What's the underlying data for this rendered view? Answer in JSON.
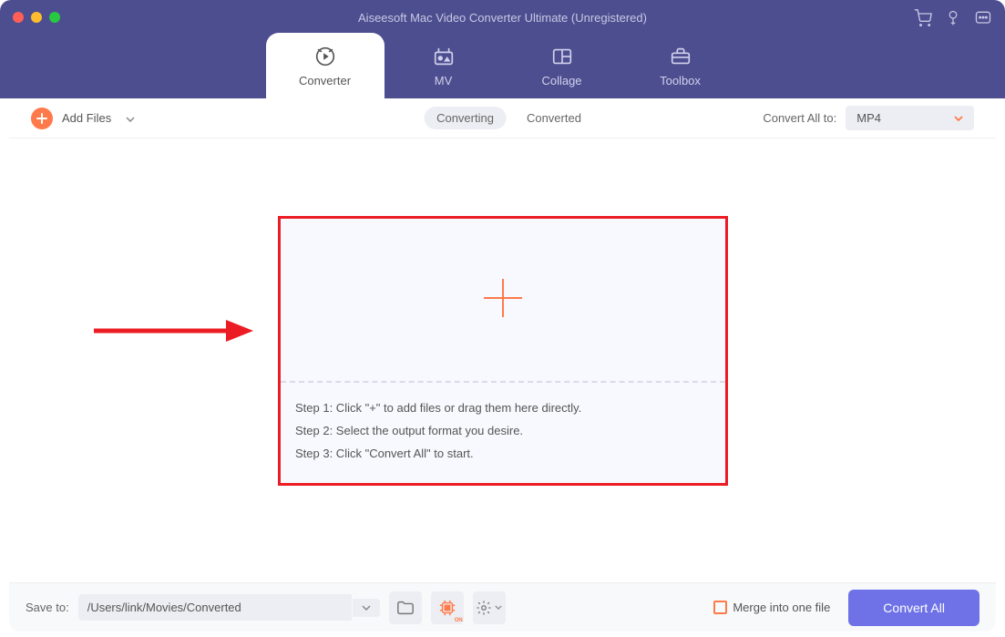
{
  "window": {
    "title": "Aiseesoft Mac Video Converter Ultimate (Unregistered)"
  },
  "colors": {
    "header_bg": "#4d4e8f",
    "accent_orange": "#ff7a4a",
    "primary_button": "#6e72e6",
    "highlight_border": "#ec1c24"
  },
  "tabs": [
    {
      "label": "Converter",
      "icon": "converter-icon",
      "active": true
    },
    {
      "label": "MV",
      "icon": "mv-icon",
      "active": false
    },
    {
      "label": "Collage",
      "icon": "collage-icon",
      "active": false
    },
    {
      "label": "Toolbox",
      "icon": "toolbox-icon",
      "active": false
    }
  ],
  "toolbar": {
    "add_files_label": "Add Files",
    "center": {
      "converting_label": "Converting",
      "converted_label": "Converted",
      "active": "Converting"
    },
    "convert_to_label": "Convert All to:",
    "format_selected": "MP4"
  },
  "dropzone": {
    "steps": [
      "Step 1: Click \"+\" to add files or drag them here directly.",
      "Step 2: Select the output format you desire.",
      "Step 3: Click \"Convert All\" to start."
    ]
  },
  "footer": {
    "save_to_label": "Save to:",
    "save_path": "/Users/link/Movies/Converted",
    "merge_label": "Merge into one file",
    "merge_checked": false,
    "convert_all_label": "Convert All"
  }
}
